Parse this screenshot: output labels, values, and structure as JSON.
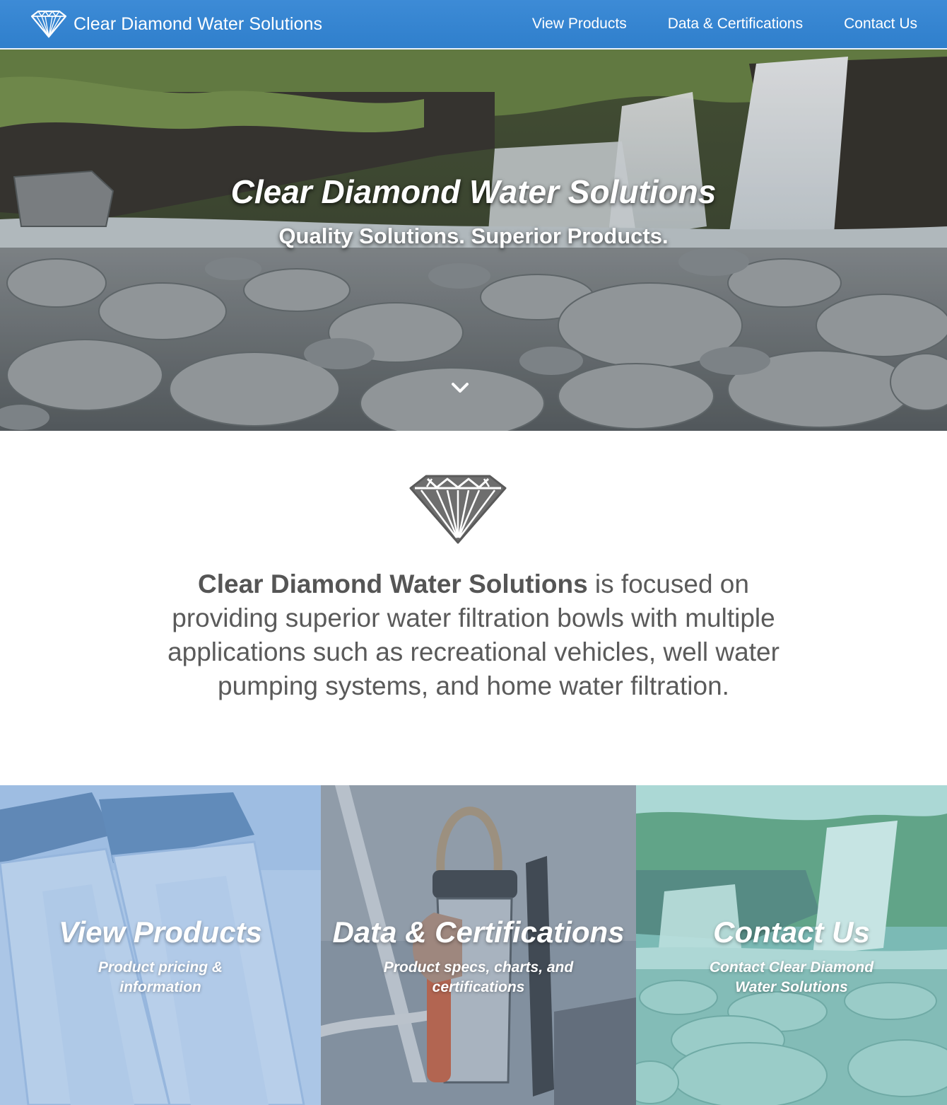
{
  "nav": {
    "brand": "Clear Diamond Water Solutions",
    "links": [
      "View Products",
      "Data & Certifications",
      "Contact Us"
    ]
  },
  "hero": {
    "title": "Clear Diamond Water Solutions",
    "subtitle": "Quality Solutions. Superior Products."
  },
  "intro": {
    "company": "Clear Diamond Water Solutions",
    "text": " is focused on providing superior water filtration bowls with multiple applications such as recreational vehicles, well water pumping systems, and home water filtration."
  },
  "tiles": [
    {
      "title": "View Products",
      "subtitle": "Product pricing & information"
    },
    {
      "title": "Data & Certifications",
      "subtitle": "Product specs, charts, and certifications"
    },
    {
      "title": "Contact Us",
      "subtitle": "Contact Clear Diamond Water Solutions"
    }
  ],
  "colors": {
    "nav_blue": "#3484d0",
    "text_gray": "#5a5a5a",
    "tile_blue": "#9fc0e6",
    "tile_slate": "#7c8fa3",
    "tile_teal": "#7fc6c0"
  },
  "icons": [
    "diamond-logo-icon",
    "chevron-down-icon",
    "diamond-icon"
  ]
}
